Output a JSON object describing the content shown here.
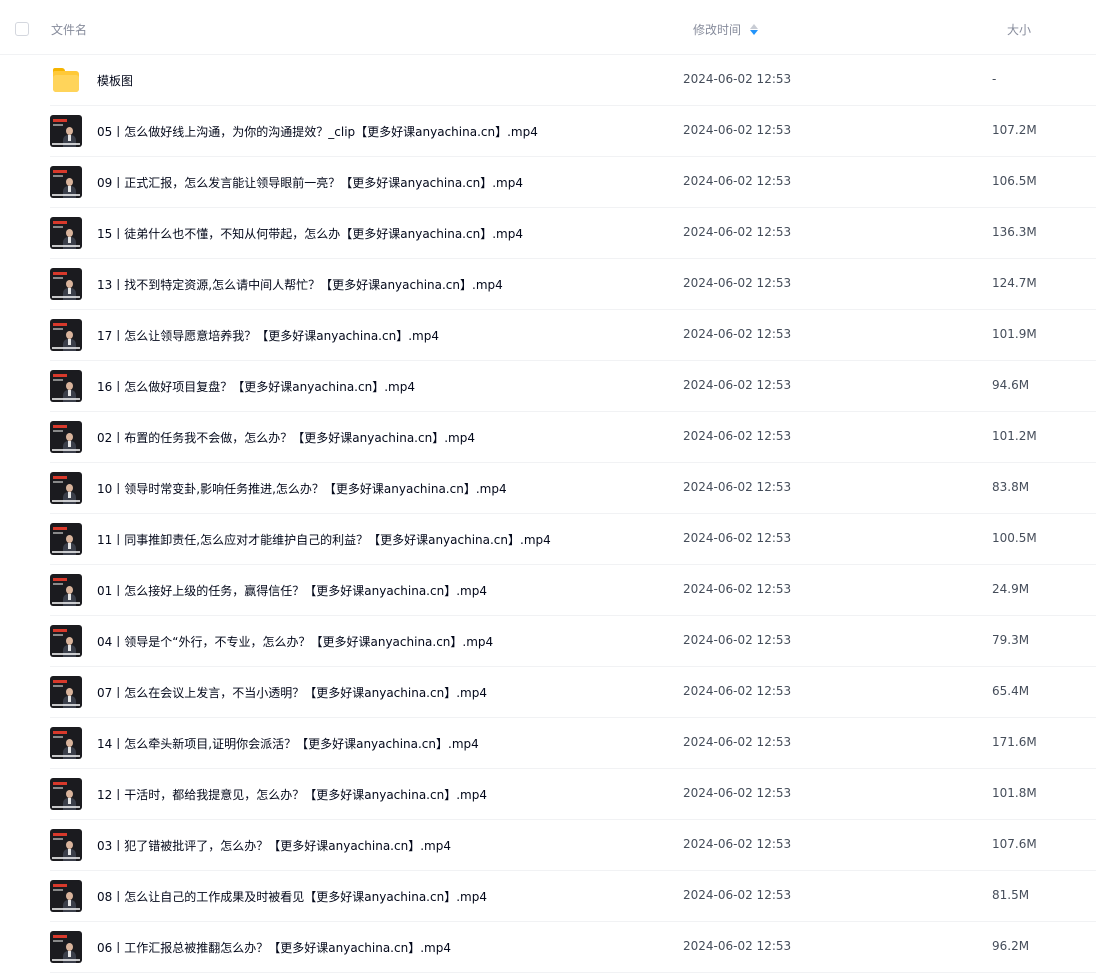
{
  "header": {
    "name_label": "文件名",
    "time_label": "修改时间",
    "size_label": "大小",
    "sort_icon": "sort-descending-icon",
    "accent_color": "#2394fa"
  },
  "rows": [
    {
      "type": "folder",
      "icon": "folder-icon",
      "name": "模板图",
      "time": "2024-06-02 12:53",
      "size": "-"
    },
    {
      "type": "video",
      "icon": "video-thumbnail",
      "name": "05丨怎么做好线上沟通，为你的沟通提效？_clip【更多好课anyachina.cn】.mp4",
      "time": "2024-06-02 12:53",
      "size": "107.2M"
    },
    {
      "type": "video",
      "icon": "video-thumbnail",
      "name": "09丨正式汇报，怎么发言能让领导眼前一亮？【更多好课anyachina.cn】.mp4",
      "time": "2024-06-02 12:53",
      "size": "106.5M"
    },
    {
      "type": "video",
      "icon": "video-thumbnail",
      "name": "15丨徒弟什么也不懂，不知从何带起，怎么办【更多好课anyachina.cn】.mp4",
      "time": "2024-06-02 12:53",
      "size": "136.3M"
    },
    {
      "type": "video",
      "icon": "video-thumbnail",
      "name": "13丨找不到特定资源,怎么请中间人帮忙？【更多好课anyachina.cn】.mp4",
      "time": "2024-06-02 12:53",
      "size": "124.7M"
    },
    {
      "type": "video",
      "icon": "video-thumbnail",
      "name": "17丨怎么让领导愿意培养我？【更多好课anyachina.cn】.mp4",
      "time": "2024-06-02 12:53",
      "size": "101.9M"
    },
    {
      "type": "video",
      "icon": "video-thumbnail",
      "name": "16丨怎么做好项目复盘？【更多好课anyachina.cn】.mp4",
      "time": "2024-06-02 12:53",
      "size": "94.6M"
    },
    {
      "type": "video",
      "icon": "video-thumbnail",
      "name": "02丨布置的任务我不会做，怎么办？【更多好课anyachina.cn】.mp4",
      "time": "2024-06-02 12:53",
      "size": "101.2M"
    },
    {
      "type": "video",
      "icon": "video-thumbnail",
      "name": "10丨领导时常变卦,影响任务推进,怎么办？【更多好课anyachina.cn】.mp4",
      "time": "2024-06-02 12:53",
      "size": "83.8M"
    },
    {
      "type": "video",
      "icon": "video-thumbnail",
      "name": "11丨同事推卸责任,怎么应对才能维护自己的利益？【更多好课anyachina.cn】.mp4",
      "time": "2024-06-02 12:53",
      "size": "100.5M"
    },
    {
      "type": "video",
      "icon": "video-thumbnail",
      "name": "01丨怎么接好上级的任务，赢得信任？【更多好课anyachina.cn】.mp4",
      "time": "2024-06-02 12:53",
      "size": "24.9M"
    },
    {
      "type": "video",
      "icon": "video-thumbnail",
      "name": "04丨领导是个“外行，不专业，怎么办？【更多好课anyachina.cn】.mp4",
      "time": "2024-06-02 12:53",
      "size": "79.3M"
    },
    {
      "type": "video",
      "icon": "video-thumbnail",
      "name": "07丨怎么在会议上发言，不当小透明？【更多好课anyachina.cn】.mp4",
      "time": "2024-06-02 12:53",
      "size": "65.4M"
    },
    {
      "type": "video",
      "icon": "video-thumbnail",
      "name": "14丨怎么牵头新项目,证明你会派活？【更多好课anyachina.cn】.mp4",
      "time": "2024-06-02 12:53",
      "size": "171.6M"
    },
    {
      "type": "video",
      "icon": "video-thumbnail",
      "name": "12丨干活时，都给我提意见，怎么办？【更多好课anyachina.cn】.mp4",
      "time": "2024-06-02 12:53",
      "size": "101.8M"
    },
    {
      "type": "video",
      "icon": "video-thumbnail",
      "name": "03丨犯了错被批评了，怎么办？【更多好课anyachina.cn】.mp4",
      "time": "2024-06-02 12:53",
      "size": "107.6M"
    },
    {
      "type": "video",
      "icon": "video-thumbnail",
      "name": "08丨怎么让自己的工作成果及时被看见【更多好课anyachina.cn】.mp4",
      "time": "2024-06-02 12:53",
      "size": "81.5M"
    },
    {
      "type": "video",
      "icon": "video-thumbnail",
      "name": "06丨工作汇报总被推翻怎么办？【更多好课anyachina.cn】.mp4",
      "time": "2024-06-02 12:53",
      "size": "96.2M"
    }
  ]
}
